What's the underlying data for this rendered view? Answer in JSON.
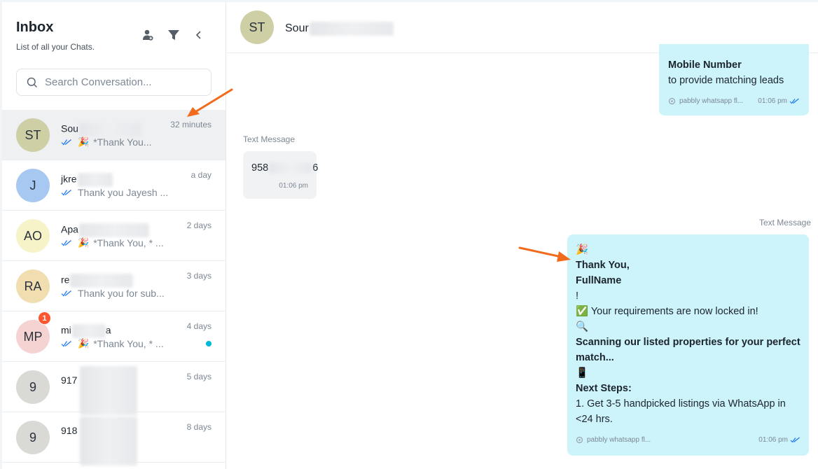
{
  "sidebar": {
    "title": "Inbox",
    "subtitle": "List of all your Chats.",
    "search_placeholder": "Search Conversation...",
    "icons": [
      "add-contact-icon",
      "filter-icon",
      "chevron-left-icon"
    ],
    "conversations": [
      {
        "initials": "ST",
        "name": "Sou",
        "time": "32 minutes",
        "preview": "*Thank You...",
        "emoji": "🎉",
        "avatar_color": "#cfcfa6",
        "active": true
      },
      {
        "initials": "J",
        "name": "jkre",
        "time": "a day",
        "preview": "Thank you Jayesh ...",
        "emoji": "",
        "avatar_color": "#a7c8f0"
      },
      {
        "initials": "AO",
        "name": "Apa",
        "time": "2 days",
        "preview": "*Thank You, * ...",
        "emoji": "🎉",
        "avatar_color": "#f7f3c9"
      },
      {
        "initials": "RA",
        "name": "re",
        "time": "3 days",
        "preview": "Thank you for sub...",
        "emoji": "",
        "avatar_color": "#f1deb0"
      },
      {
        "initials": "MP",
        "name": "mi",
        "name_tail": "a",
        "time": "4 days",
        "preview": "*Thank You, * ...",
        "emoji": "🎉",
        "avatar_color": "#f6d3d3",
        "badge": "1",
        "unread_dot": true
      },
      {
        "initials": "9",
        "name": "917",
        "time": "5 days",
        "preview": "",
        "emoji": "",
        "avatar_color": "#d9d9d6"
      },
      {
        "initials": "9",
        "name": "918",
        "time": "8 days",
        "preview": "",
        "emoji": "",
        "avatar_color": "#d9d9d6"
      }
    ]
  },
  "chat": {
    "contact_initials": "ST",
    "contact_name": "Sour",
    "messages": {
      "top_out": {
        "lines": [
          {
            "text": "Mobile Number",
            "bold": true
          },
          {
            "text": "to provide matching leads",
            "bold": false
          }
        ],
        "source": "pabbly whatsapp fl...",
        "time": "01:06 pm"
      },
      "in_msg": {
        "label": "Text Message",
        "text": "958",
        "text_tail": "6",
        "time": "01:06 pm"
      },
      "bottom_out": {
        "label": "Text Message",
        "lines": [
          {
            "text": "🎉",
            "bold": false
          },
          {
            "text": "Thank You,",
            "bold": true
          },
          {
            "text": "FullName",
            "bold": true
          },
          {
            "text": "!",
            "bold": false
          },
          {
            "text": "✅ Your requirements are now locked in!",
            "bold": false
          },
          {
            "text": "🔍",
            "bold": false
          },
          {
            "text": "Scanning our listed properties for your perfect",
            "bold": true
          },
          {
            "text": "match...",
            "bold": true
          },
          {
            "text": "📱",
            "bold": false
          },
          {
            "text": "Next Steps:",
            "bold": true
          },
          {
            "text": "1. Get 3-5 handpicked listings via WhatsApp in",
            "bold": false
          },
          {
            "text": "<24 hrs.",
            "bold": false
          }
        ],
        "source": "pabbly whatsapp fl...",
        "time": "01:06 pm"
      }
    }
  },
  "colors": {
    "accent_arrow": "#f26b1d",
    "outgoing_bubble": "#cdf3fb",
    "incoming_bubble": "#f1f2f4",
    "tick": "#1877f2",
    "unread_dot": "#00b8d9",
    "badge": "#ff5630"
  }
}
